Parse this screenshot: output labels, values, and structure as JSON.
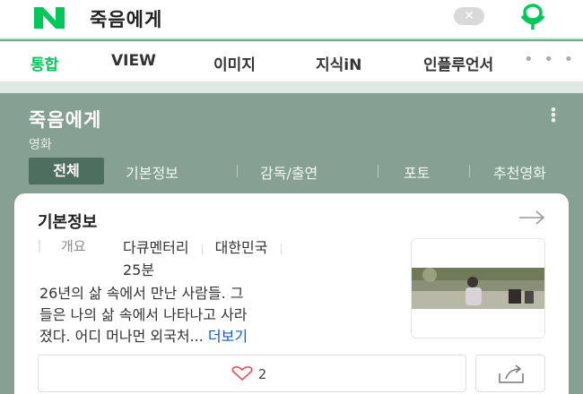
{
  "search": {
    "logo_letter": "N",
    "query": "죽음에게",
    "clear_label": "✕"
  },
  "tabs": [
    {
      "label": "통합",
      "active": true
    },
    {
      "label": "VIEW"
    },
    {
      "label": "이미지"
    },
    {
      "label": "지식iN"
    },
    {
      "label": "인플루언서"
    }
  ],
  "more_tabs_label": "• • •",
  "movie": {
    "title": "죽음에게",
    "kind": "영화"
  },
  "subtabs": [
    {
      "label": "전체",
      "active": true
    },
    {
      "label": "기본정보"
    },
    {
      "label": "감독/출연"
    },
    {
      "label": "포토"
    },
    {
      "label": "추천영화"
    }
  ],
  "card": {
    "title": "기본정보",
    "overview_label": "개요",
    "genre": "다큐멘터리",
    "country": "대한민국",
    "runtime": "25분",
    "description_line1": "26년의 삶 속에서 만난 사람들. 그",
    "description_line2": "들은 나의 삶 속에서 나타나고 사라",
    "description_line3": "졌다. 어디 머나먼 외국처...",
    "more_label": "더보기",
    "like_count": "2"
  },
  "colors": {
    "brand_green": "#03c75a",
    "hero_bg": "#86a194",
    "active_subtab": "#4e6f5f",
    "link": "#0c5ec6"
  }
}
